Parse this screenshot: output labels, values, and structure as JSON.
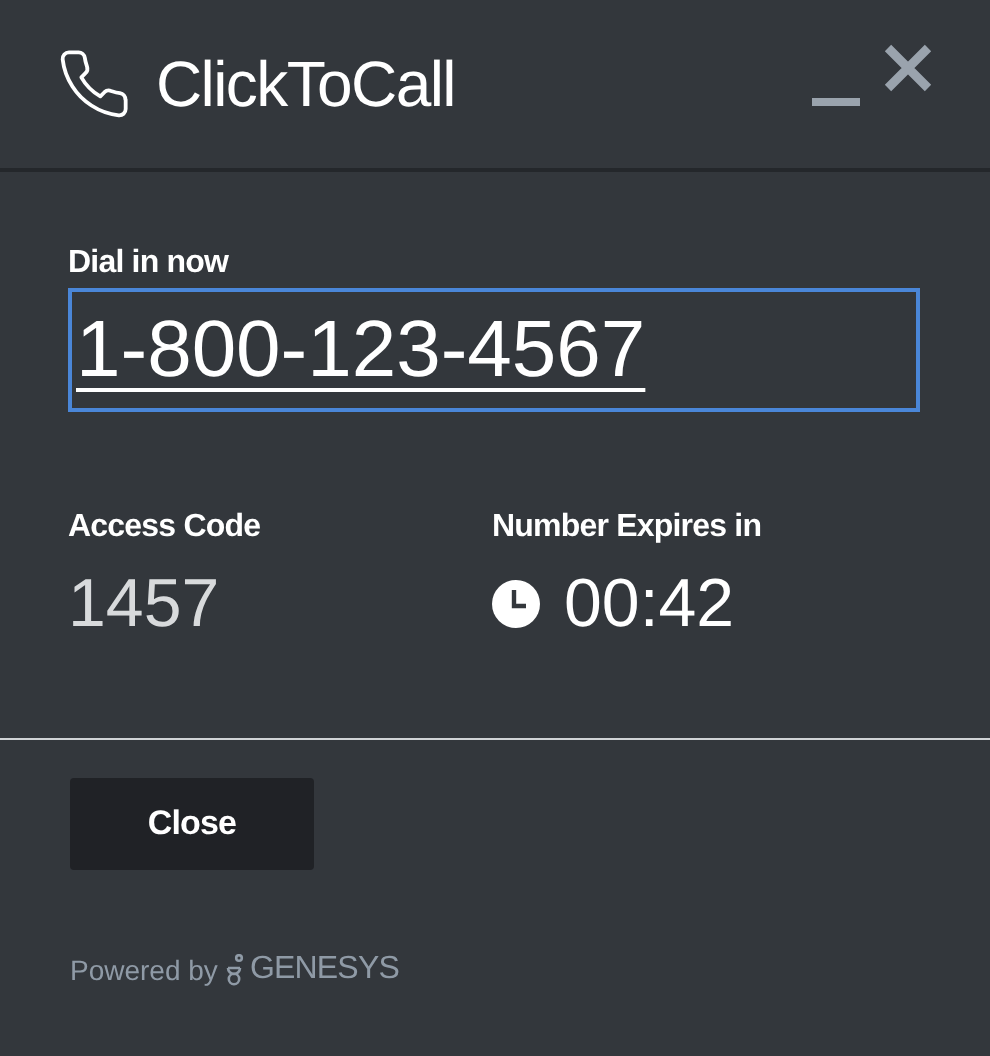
{
  "window": {
    "title": "ClickToCall"
  },
  "dial_in": {
    "label": "Dial in now",
    "number": "1-800-123-4567"
  },
  "access_code": {
    "label": "Access Code",
    "value": "1457"
  },
  "expires": {
    "label": "Number Expires in",
    "value": "00:42"
  },
  "buttons": [
    "Close"
  ],
  "footer": {
    "text": "Powered by",
    "brand": "GENESYS"
  }
}
